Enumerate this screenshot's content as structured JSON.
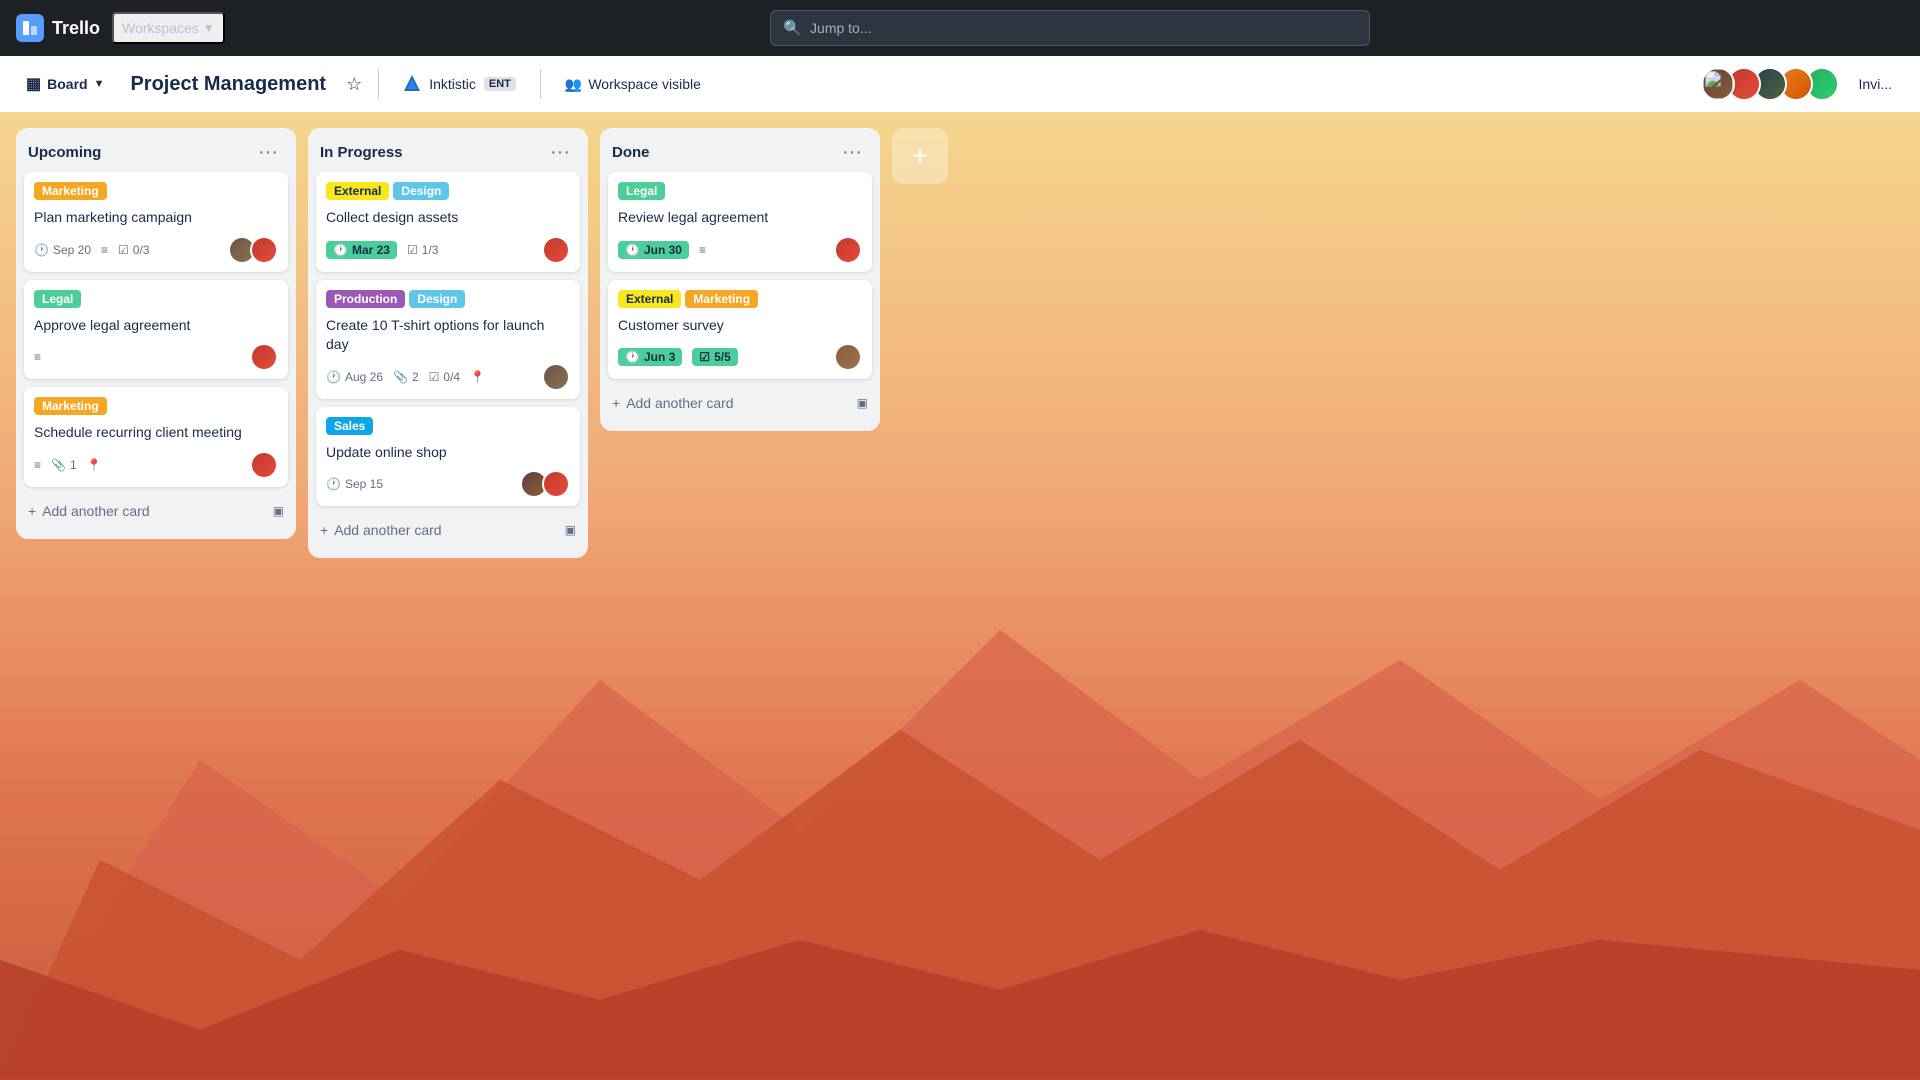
{
  "app": {
    "name": "Trello"
  },
  "nav": {
    "workspaces_label": "Workspaces",
    "search_placeholder": "Jump to..."
  },
  "board_header": {
    "board_label": "Board",
    "board_title": "Project Management",
    "workspace_name": "Inktistic",
    "workspace_tag": "ENT",
    "visibility_label": "Workspace visible",
    "invite_label": "Invi..."
  },
  "columns": [
    {
      "id": "upcoming",
      "title": "Upcoming",
      "cards": [
        {
          "id": "c1",
          "tags": [
            {
              "label": "Marketing",
              "class": "tag-marketing"
            }
          ],
          "title": "Plan marketing campaign",
          "meta": [
            {
              "icon": "clock",
              "text": "Sep 20"
            },
            {
              "icon": "lines",
              "text": ""
            },
            {
              "icon": "check",
              "text": "0/3"
            }
          ],
          "avatars": [
            "a1",
            "a2"
          ]
        },
        {
          "id": "c2",
          "tags": [
            {
              "label": "Legal",
              "class": "tag-legal"
            }
          ],
          "title": "Approve legal agreement",
          "meta": [
            {
              "icon": "lines",
              "text": ""
            }
          ],
          "avatars": [
            "a3"
          ]
        },
        {
          "id": "c3",
          "tags": [
            {
              "label": "Marketing",
              "class": "tag-marketing"
            }
          ],
          "title": "Schedule recurring client meeting",
          "meta": [
            {
              "icon": "lines",
              "text": ""
            },
            {
              "icon": "clip",
              "text": "1"
            },
            {
              "icon": "pin",
              "text": ""
            }
          ],
          "avatars": [
            "a4"
          ]
        }
      ],
      "add_card_label": "+ Add another card"
    },
    {
      "id": "inprogress",
      "title": "In Progress",
      "cards": [
        {
          "id": "c4",
          "tags": [
            {
              "label": "External",
              "class": "tag-external"
            },
            {
              "label": "Design",
              "class": "tag-design"
            }
          ],
          "title": "Collect design assets",
          "meta": [
            {
              "icon": "clock-green",
              "text": "Mar 23"
            },
            {
              "icon": "check",
              "text": "1/3"
            }
          ],
          "avatars": [
            "a5"
          ]
        },
        {
          "id": "c5",
          "tags": [
            {
              "label": "Production",
              "class": "tag-production"
            },
            {
              "label": "Design",
              "class": "tag-design"
            }
          ],
          "title": "Create 10 T-shirt options for launch day",
          "meta": [
            {
              "icon": "clock",
              "text": "Aug 26"
            },
            {
              "icon": "clip",
              "text": "2"
            },
            {
              "icon": "check",
              "text": "0/4"
            },
            {
              "icon": "pin",
              "text": ""
            }
          ],
          "avatars": [
            "a6"
          ]
        },
        {
          "id": "c6",
          "tags": [
            {
              "label": "Sales",
              "class": "tag-sales"
            }
          ],
          "title": "Update online shop",
          "meta": [
            {
              "icon": "clock",
              "text": "Sep 15"
            }
          ],
          "avatars": [
            "a7",
            "a8"
          ]
        }
      ],
      "add_card_label": "+ Add another card"
    },
    {
      "id": "done",
      "title": "Done",
      "cards": [
        {
          "id": "c7",
          "tags": [
            {
              "label": "Legal",
              "class": "tag-legal"
            }
          ],
          "title": "Review legal agreement",
          "meta": [
            {
              "icon": "clock-green",
              "text": "Jun 30"
            },
            {
              "icon": "lines",
              "text": ""
            }
          ],
          "avatars": [
            "a9"
          ]
        },
        {
          "id": "c8",
          "tags": [
            {
              "label": "External",
              "class": "tag-external"
            },
            {
              "label": "Marketing",
              "class": "tag-marketing"
            }
          ],
          "title": "Customer survey",
          "meta": [
            {
              "icon": "clock-green",
              "text": "Jun 3"
            },
            {
              "icon": "check-green",
              "text": "5/5"
            }
          ],
          "avatars": [
            "a10"
          ]
        }
      ],
      "add_card_label": "+ Add another card"
    }
  ],
  "avatars": {
    "a1": {
      "bg": "#6b5344",
      "initials": ""
    },
    "a2": {
      "bg": "#c0392b",
      "initials": ""
    },
    "a3": {
      "bg": "#c0392b",
      "initials": ""
    },
    "a4": {
      "bg": "#c0392b",
      "initials": ""
    },
    "a5": {
      "bg": "#c0392b",
      "initials": ""
    },
    "a6": {
      "bg": "#6b5344",
      "initials": ""
    },
    "a7": {
      "bg": "#5d4037",
      "initials": ""
    },
    "a8": {
      "bg": "#c0392b",
      "initials": ""
    },
    "a9": {
      "bg": "#c0392b",
      "initials": ""
    },
    "a10": {
      "bg": "#8b5e3c",
      "initials": ""
    }
  }
}
